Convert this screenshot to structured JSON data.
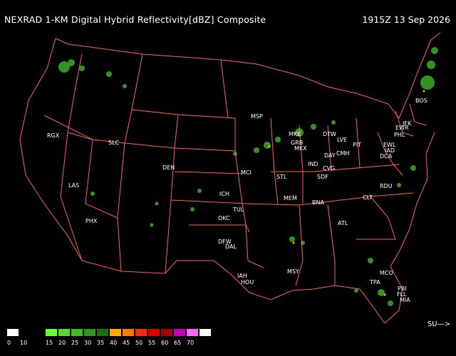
{
  "header": {
    "title": "NEXRAD 1-KM Digital Hybrid Reflectivity[dBZ] Composite",
    "timestamp": "1915Z 13 Sep 2026"
  },
  "map": {
    "border_color": "#ff5a5a",
    "stations": [
      "RGX",
      "SLC",
      "DEN",
      "LAS",
      "PHX",
      "MSP",
      "MKE",
      "GRB",
      "MKX",
      "DTW",
      "LVE",
      "PIT",
      "EWR",
      "PHL",
      "JFK",
      "BOS",
      "EWL",
      "IAD",
      "DCA",
      "IND",
      "DAY",
      "CMH",
      "CVG",
      "SDF",
      "STL",
      "MCI",
      "ICH",
      "TUL",
      "OKC",
      "DFW",
      "DAL",
      "MEM",
      "BNA",
      "ATL",
      "CLT",
      "RDU",
      "IAH",
      "HOU",
      "MSY",
      "MCO",
      "TPA",
      "PBI",
      "FLL",
      "MIA"
    ]
  },
  "legend": {
    "colors": [
      "#ffffff",
      "#000000",
      "#000000",
      "#66ff33",
      "#59d92d",
      "#3fb928",
      "#2f9520",
      "#1f6c16",
      "#ffaa00",
      "#ff7a00",
      "#ff2a00",
      "#d80000",
      "#a30000",
      "#c000c0",
      "#ff66ff",
      "#ffffff"
    ],
    "ticks": [
      "0",
      "10",
      "15",
      "20",
      "25",
      "30",
      "35",
      "40",
      "45",
      "50",
      "55",
      "60",
      "65",
      "70"
    ]
  },
  "credit": "SU—>"
}
